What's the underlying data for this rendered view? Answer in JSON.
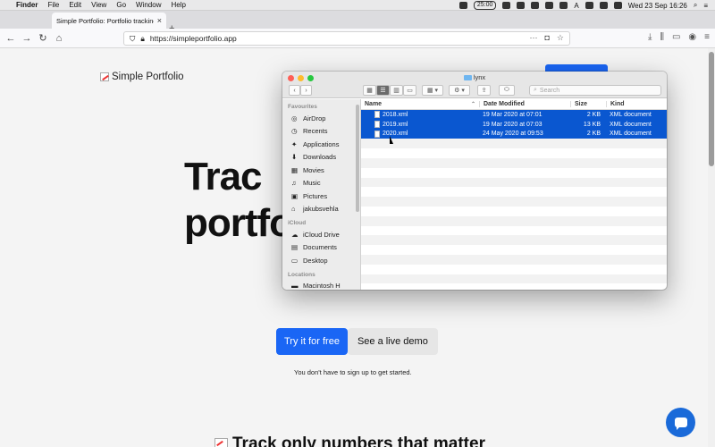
{
  "menubar": {
    "apple_glyph": "",
    "items": [
      {
        "label": "Finder",
        "bold": true
      },
      {
        "label": "File"
      },
      {
        "label": "Edit"
      },
      {
        "label": "View"
      },
      {
        "label": "Go"
      },
      {
        "label": "Window"
      },
      {
        "label": "Help"
      }
    ],
    "timer": "25:00",
    "clock": "Wed 23 Sep  16:26",
    "input_letter": "A"
  },
  "browser": {
    "tab_title": "Simple Portfolio: Portfolio tracking f",
    "tab_close": "×",
    "new_tab": "+",
    "url": "https://simpleportfolio.app",
    "back": "←",
    "forward": "→",
    "reload": "↻",
    "home": "⌂",
    "url_more": "···",
    "menu": "≡"
  },
  "page": {
    "brand": "Simple Portfolio",
    "hero_line1": "Trac",
    "hero_line2": "portfo",
    "primary_cta": "Try it for free",
    "secondary_cta": "See a live demo",
    "signup_note": "You don't have to sign up to get started.",
    "sub_heading": "Track only numbers that matter"
  },
  "finder": {
    "title": "lynx",
    "search_placeholder": "Search",
    "sidebar": {
      "favourites_label": "Favourites",
      "favourites": [
        {
          "label": "AirDrop",
          "icon": "airdrop-icon"
        },
        {
          "label": "Recents",
          "icon": "clock-icon"
        },
        {
          "label": "Applications",
          "icon": "applications-icon"
        },
        {
          "label": "Downloads",
          "icon": "downloads-icon"
        },
        {
          "label": "Movies",
          "icon": "movies-icon"
        },
        {
          "label": "Music",
          "icon": "music-icon"
        },
        {
          "label": "Pictures",
          "icon": "pictures-icon"
        },
        {
          "label": "jakubsvehla",
          "icon": "home-icon"
        }
      ],
      "icloud_label": "iCloud",
      "icloud": [
        {
          "label": "iCloud Drive",
          "icon": "cloud-icon"
        },
        {
          "label": "Documents",
          "icon": "document-icon"
        },
        {
          "label": "Desktop",
          "icon": "desktop-icon"
        }
      ],
      "locations_label": "Locations",
      "locations": [
        {
          "label": "Macintosh H",
          "icon": "disk-icon"
        }
      ]
    },
    "columns": {
      "name": "Name",
      "date": "Date Modified",
      "size": "Size",
      "kind": "Kind"
    },
    "files": [
      {
        "name": "2018.xml",
        "date": "19 Mar 2020 at 07:01",
        "size": "2 KB",
        "kind": "XML document"
      },
      {
        "name": "2019.xml",
        "date": "19 Mar 2020 at 07:03",
        "size": "13 KB",
        "kind": "XML document"
      },
      {
        "name": "2020.xml",
        "date": "24 May 2020 at 09:53",
        "size": "2 KB",
        "kind": "XML document"
      }
    ]
  },
  "colors": {
    "accent": "#1a66f5",
    "selection": "#0a57d0",
    "chat": "#1a6ad9"
  }
}
